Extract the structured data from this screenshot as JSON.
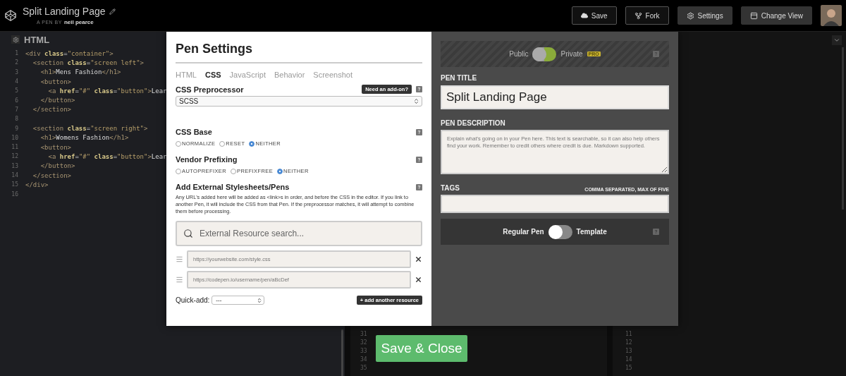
{
  "header": {
    "title": "Split Landing Page",
    "byline_prefix": "A PEN BY",
    "author": "neil pearce",
    "buttons": [
      {
        "label": "Save",
        "kind": "outline"
      },
      {
        "label": "Fork",
        "kind": "outline"
      },
      {
        "label": "Settings",
        "kind": "filled"
      },
      {
        "label": "Change View",
        "kind": "filled"
      }
    ]
  },
  "editor": {
    "title": "HTML",
    "lines": [
      {
        "number": "1",
        "tokens": [
          {
            "kind": "tag",
            "text": "<div"
          },
          {
            "kind": "attr",
            "text": " class"
          },
          {
            "kind": "punct",
            "text": "="
          },
          {
            "kind": "string",
            "text": "\"container\""
          },
          {
            "kind": "tag",
            "text": ">"
          }
        ]
      },
      {
        "number": "2",
        "tokens": [
          {
            "kind": "tag",
            "text": "  <section"
          },
          {
            "kind": "attr",
            "text": " class"
          },
          {
            "kind": "punct",
            "text": "="
          },
          {
            "kind": "string",
            "text": "\"screen left\""
          },
          {
            "kind": "tag",
            "text": ">"
          }
        ]
      },
      {
        "number": "3",
        "tokens": [
          {
            "kind": "tag",
            "text": "    <h1>"
          },
          {
            "kind": "text",
            "text": "Mens Fashion"
          },
          {
            "kind": "tag",
            "text": "</h1>"
          }
        ]
      },
      {
        "number": "4",
        "tokens": [
          {
            "kind": "tag",
            "text": "    <button>"
          }
        ]
      },
      {
        "number": "5",
        "tokens": [
          {
            "kind": "tag",
            "text": "      <a"
          },
          {
            "kind": "attr",
            "text": " href"
          },
          {
            "kind": "punct",
            "text": "="
          },
          {
            "kind": "string",
            "text": "\"#\""
          },
          {
            "kind": "attr",
            "text": " class"
          },
          {
            "kind": "punct",
            "text": "="
          },
          {
            "kind": "string",
            "text": "\"button\""
          },
          {
            "kind": "tag",
            "text": ">"
          },
          {
            "kind": "text",
            "text": "Lear"
          }
        ]
      },
      {
        "number": "6",
        "tokens": [
          {
            "kind": "tag",
            "text": "    </button>"
          }
        ]
      },
      {
        "number": "7",
        "tokens": [
          {
            "kind": "tag",
            "text": "  </section>"
          }
        ]
      },
      {
        "number": "8"
      },
      {
        "number": "9",
        "tokens": [
          {
            "kind": "tag",
            "text": "  <section"
          },
          {
            "kind": "attr",
            "text": " class"
          },
          {
            "kind": "punct",
            "text": "="
          },
          {
            "kind": "string",
            "text": "\"screen right\""
          },
          {
            "kind": "tag",
            "text": ">"
          }
        ]
      },
      {
        "number": "10",
        "tokens": [
          {
            "kind": "tag",
            "text": "    <h1>"
          },
          {
            "kind": "text",
            "text": "Womens Fashion"
          },
          {
            "kind": "tag",
            "text": "</h1>"
          }
        ]
      },
      {
        "number": "11",
        "tokens": [
          {
            "kind": "tag",
            "text": "    <button>"
          }
        ]
      },
      {
        "number": "12",
        "tokens": [
          {
            "kind": "tag",
            "text": "      <a"
          },
          {
            "kind": "attr",
            "text": " href"
          },
          {
            "kind": "punct",
            "text": "="
          },
          {
            "kind": "string",
            "text": "\"#\""
          },
          {
            "kind": "attr",
            "text": " class"
          },
          {
            "kind": "punct",
            "text": "="
          },
          {
            "kind": "string",
            "text": "\"button\""
          },
          {
            "kind": "tag",
            "text": ">"
          },
          {
            "kind": "text",
            "text": "Lear"
          }
        ]
      },
      {
        "number": "13",
        "tokens": [
          {
            "kind": "tag",
            "text": "    </button>"
          }
        ]
      },
      {
        "number": "14",
        "tokens": [
          {
            "kind": "tag",
            "text": "  </section>"
          }
        ]
      },
      {
        "number": "15",
        "tokens": [
          {
            "kind": "tag",
            "text": "</div>"
          }
        ]
      },
      {
        "number": "16"
      }
    ]
  },
  "middle_editor": {
    "line_numbers": [
      "31",
      "32",
      "33",
      "34",
      "35"
    ]
  },
  "right_editor": {
    "line_numbers": [
      "11",
      "12",
      "13",
      "14",
      "15"
    ]
  },
  "settings": {
    "title": "Pen Settings",
    "tabs": [
      {
        "label": "HTML",
        "selected": false
      },
      {
        "label": "CSS",
        "selected": true
      },
      {
        "label": "JavaScript",
        "selected": false
      },
      {
        "label": "Behavior",
        "selected": false
      },
      {
        "label": "Screenshot",
        "selected": false
      }
    ],
    "preprocessor": {
      "label": "CSS Preprocessor",
      "addon": "Need an add-on?",
      "value": "SCSS"
    },
    "css_base": {
      "label": "CSS Base",
      "options": [
        {
          "label": "NORMALIZE",
          "selected": false
        },
        {
          "label": "RESET",
          "selected": false
        },
        {
          "label": "NEITHER",
          "selected": true
        }
      ]
    },
    "vendor_prefixing": {
      "label": "Vendor Prefixing",
      "options": [
        {
          "label": "AUTOPREFIXER",
          "selected": false
        },
        {
          "label": "PREFIXFREE",
          "selected": false
        },
        {
          "label": "NEITHER",
          "selected": true
        }
      ]
    },
    "external": {
      "label": "Add External Stylesheets/Pens",
      "description": "Any URL's added here will be added as <link>s in order, and before the CSS in the editor. If you link to another Pen, it will include the CSS from that Pen. If the preprocessor matches, it will attempt to combine them before processing.",
      "search_placeholder": "External Resource search...",
      "resources": [
        {
          "placeholder": "https://yourwebsite.com/style.css"
        },
        {
          "placeholder": "https://codepen.io/username/pen/aBcDef"
        }
      ],
      "quick_add_label": "Quick-add:",
      "quick_add_value": "---",
      "add_button": "+ add another resource"
    },
    "privacy": {
      "left": "Public",
      "right": "Private",
      "badge": "PRO",
      "on": false
    },
    "pen_title": {
      "label": "PEN TITLE",
      "value": "Split Landing Page"
    },
    "pen_description": {
      "label": "PEN DESCRIPTION",
      "placeholder": "Explain what's going on in your Pen here. This text is searchable, so it can also help others find your work. Remember to credit others where credit is due. Markdown supported."
    },
    "tags": {
      "label": "TAGS",
      "hint": "COMMA SEPARATED, MAX OF FIVE"
    },
    "template": {
      "left": "Regular Pen",
      "right": "Template",
      "on": false
    },
    "save_button": "Save & Close"
  }
}
